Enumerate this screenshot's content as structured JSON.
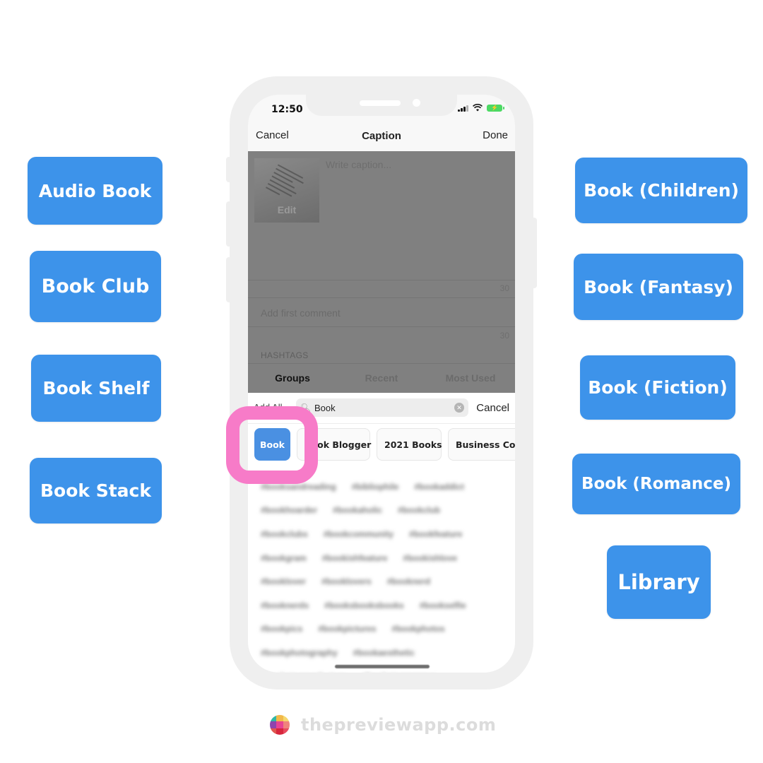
{
  "left_buttons": [
    "Audio Book",
    "Book Club",
    "Book Shelf",
    "Book Stack"
  ],
  "right_buttons": [
    "Book (Children)",
    "Book (Fantasy)",
    "Book (Fiction)",
    "Book (Romance)",
    "Library"
  ],
  "colors": {
    "category_button": "#3d93ea",
    "selected_chip": "#4a90e2",
    "highlight": "#f77bc8",
    "battery": "#4cd964"
  },
  "status_bar": {
    "time": "12:50",
    "icons": [
      "signal-icon",
      "wifi-icon",
      "battery-charging-icon"
    ]
  },
  "navbar": {
    "cancel": "Cancel",
    "title": "Caption",
    "done": "Done"
  },
  "editor": {
    "thumbnail_edit": "Edit",
    "caption_placeholder": "Write caption...",
    "caption_count": "30",
    "comment_placeholder": "Add first comment",
    "comment_count": "30",
    "hashtags_label": "HASHTAGS"
  },
  "tabs": [
    {
      "label": "Groups",
      "active": true
    },
    {
      "label": "Recent",
      "active": false
    },
    {
      "label": "Most Used",
      "active": false
    }
  ],
  "search": {
    "add_all": "Add All",
    "value": "Book",
    "cancel": "Cancel"
  },
  "chips": [
    {
      "label": "Book",
      "selected": true
    },
    {
      "label": "Book Blogger",
      "selected": false
    },
    {
      "label": "2021 Books",
      "selected": false
    },
    {
      "label": "Business Coach",
      "selected": false
    }
  ],
  "hashtag_rows": [
    [
      "#booksandreading",
      "#bibliophile",
      "#bookaddict"
    ],
    [
      "#bookhoarder",
      "#bookaholic",
      "#bookclub"
    ],
    [
      "#bookclubs",
      "#bookcommunity",
      "#bookfeature"
    ],
    [
      "#bookgram",
      "#bookishfeature",
      "#bookishlove"
    ],
    [
      "#booklover",
      "#booklovers",
      "#booknerd"
    ],
    [
      "#booknerds",
      "#booksbooksbooks",
      "#bookselfie"
    ],
    [
      "#bookpics",
      "#bookpictures",
      "#bookphotos"
    ],
    [
      "#bookphotography",
      "#bookaesthetic"
    ],
    [
      "#bookstagramfeature",
      "#bookstagrammer"
    ]
  ],
  "footer": {
    "brand": "thepreviewapp.com"
  }
}
